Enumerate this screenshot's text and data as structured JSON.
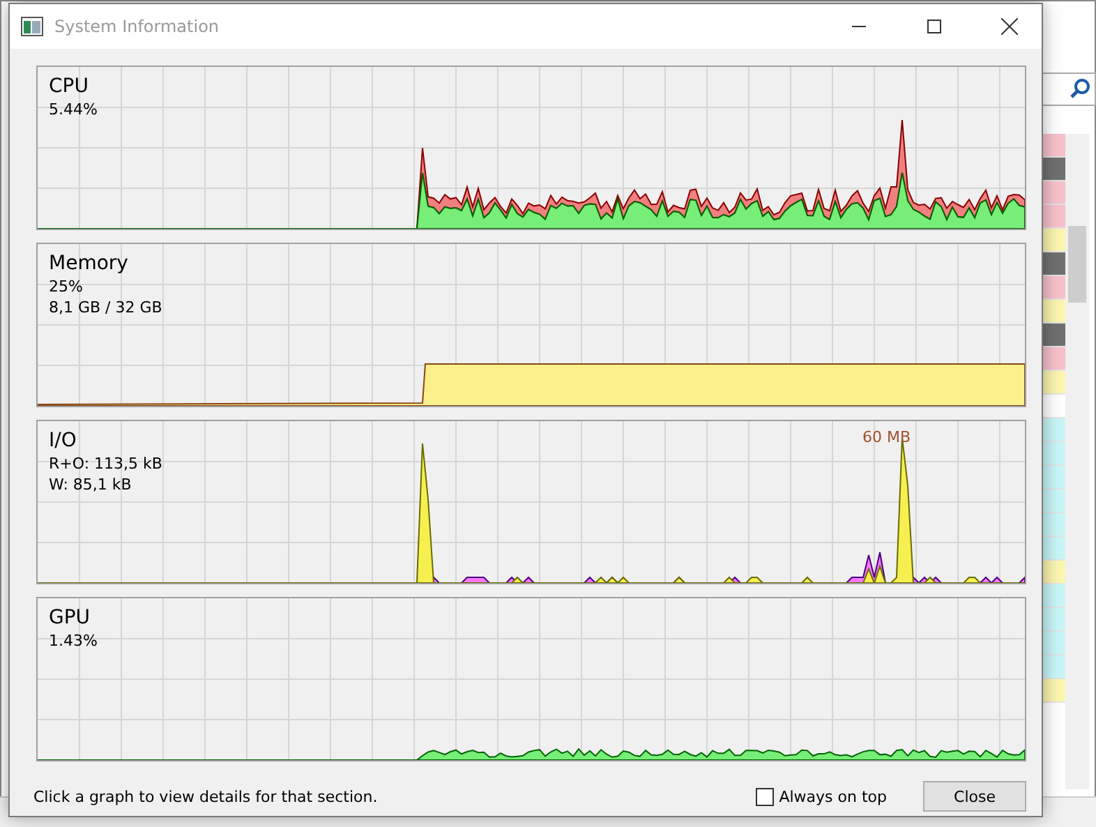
{
  "window": {
    "title": "System Information"
  },
  "graphs": [
    {
      "kind": "cpu",
      "title": "CPU",
      "lines": [
        "5.44%"
      ]
    },
    {
      "kind": "memory",
      "title": "Memory",
      "lines": [
        "25%",
        "8,1 GB / 32 GB"
      ]
    },
    {
      "kind": "io",
      "title": "I/O",
      "lines": [
        "R+O: 113,5 kB",
        "W: 85,1 kB"
      ],
      "peak_label": "60 MB"
    },
    {
      "kind": "gpu",
      "title": "GPU",
      "lines": [
        "1.43%"
      ]
    }
  ],
  "hint": "Click a graph to view details for that section.",
  "always_on_top": {
    "label": "Always on top",
    "checked": false
  },
  "close_button": "Close",
  "backdrop_rows": [
    {
      "color": "#f7c1cc"
    },
    {
      "color": "#707070"
    },
    {
      "color": "#f7c1cc"
    },
    {
      "color": "#f7c1cc"
    },
    {
      "color": "#fbf5b0"
    },
    {
      "color": "#707070"
    },
    {
      "color": "#f7c1cc"
    },
    {
      "color": "#fbf5b0"
    },
    {
      "color": "#707070"
    },
    {
      "color": "#f7c1cc"
    },
    {
      "color": "#fbf5b0"
    },
    {
      "color": "#ffffff"
    },
    {
      "color": "#c8f6f8"
    },
    {
      "color": "#c8f6f8"
    },
    {
      "color": "#c8f6f8"
    },
    {
      "color": "#c8f6f8"
    },
    {
      "color": "#c8f6f8"
    },
    {
      "color": "#c8f6f8"
    },
    {
      "color": "#fbf5b0"
    },
    {
      "color": "#c8f6f8"
    },
    {
      "color": "#c8f6f8"
    },
    {
      "color": "#c8f6f8"
    },
    {
      "color": "#c8f6f8"
    },
    {
      "color": "#fbf5b0"
    }
  ]
}
